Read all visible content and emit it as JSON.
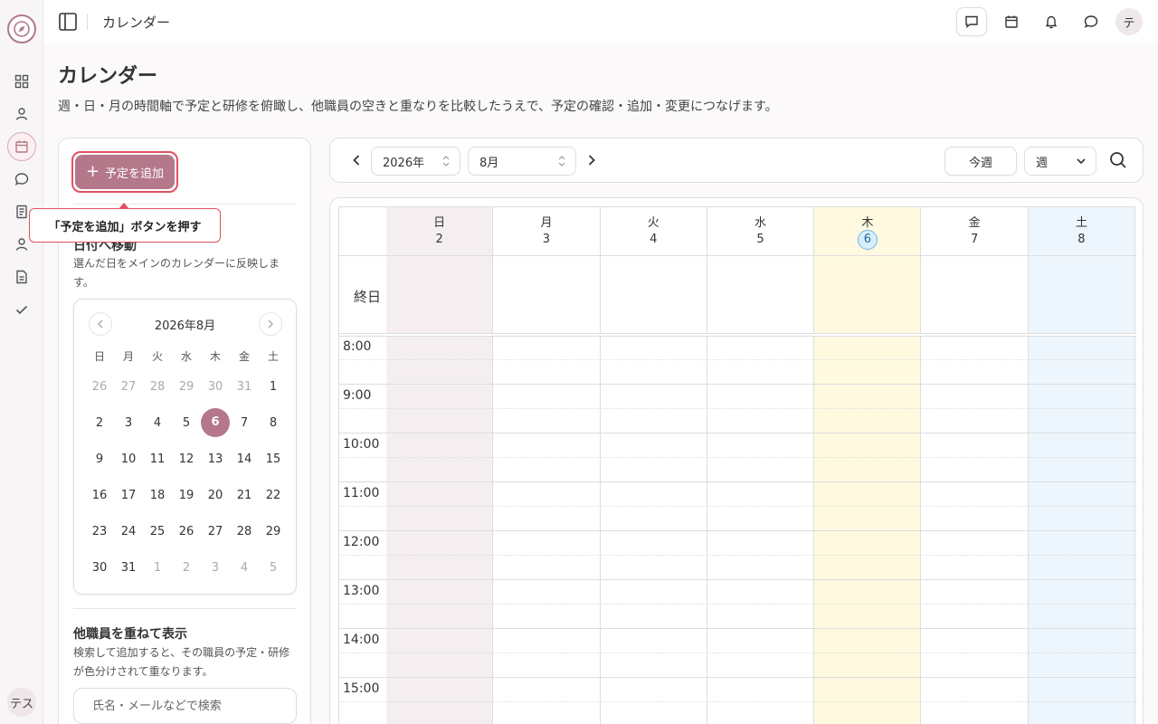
{
  "app": {
    "rail_avatar": "テス",
    "topbar_title": "カレンダー",
    "topbar_avatar": "テ"
  },
  "page": {
    "title": "カレンダー",
    "description": "週・日・月の時間軸で予定と研修を俯瞰し、他職員の空きと重なりを比較したうえで、予定の確認・追加・変更につなげます。"
  },
  "left": {
    "add_button_label": "予定を追加",
    "tooltip": "「予定を追加」ボタンを押す",
    "jump_title": "日付へ移動",
    "jump_desc": "選んだ日をメインのカレンダーに反映します。",
    "mini_cal": {
      "title": "2026年8月",
      "weekdays": [
        "日",
        "月",
        "火",
        "水",
        "木",
        "金",
        "土"
      ],
      "weeks": [
        [
          "26",
          "27",
          "28",
          "29",
          "30",
          "31",
          "1"
        ],
        [
          "2",
          "3",
          "4",
          "5",
          "6",
          "7",
          "8"
        ],
        [
          "9",
          "10",
          "11",
          "12",
          "13",
          "14",
          "15"
        ],
        [
          "16",
          "17",
          "18",
          "19",
          "20",
          "21",
          "22"
        ],
        [
          "23",
          "24",
          "25",
          "26",
          "27",
          "28",
          "29"
        ],
        [
          "30",
          "31",
          "1",
          "2",
          "3",
          "4",
          "5"
        ]
      ],
      "selected": "6"
    },
    "overlay_title": "他職員を重ねて表示",
    "overlay_desc": "検索して追加すると、その職員の予定・研修が色分けされて重なります。",
    "search_placeholder": "氏名・メールなどで検索"
  },
  "toolbar": {
    "year": "2026年",
    "month": "8月",
    "today_label": "今週",
    "view": "週"
  },
  "week": {
    "days": [
      {
        "weekday": "日",
        "date": "2"
      },
      {
        "weekday": "月",
        "date": "3"
      },
      {
        "weekday": "火",
        "date": "4"
      },
      {
        "weekday": "水",
        "date": "5"
      },
      {
        "weekday": "木",
        "date": "6"
      },
      {
        "weekday": "金",
        "date": "7"
      },
      {
        "weekday": "土",
        "date": "8"
      }
    ],
    "all_day_label": "終日",
    "hours": [
      "8:00",
      "9:00",
      "10:00",
      "11:00",
      "12:00",
      "13:00",
      "14:00",
      "15:00"
    ]
  },
  "colors": {
    "accent": "#b4788a",
    "highlight_ring": "#e05161",
    "today_column": "#fff9e0",
    "sunday_column": "#f5eef0",
    "saturday_column": "#eef6fd"
  },
  "icons": {
    "rail": [
      "dashboard-icon",
      "user-icon",
      "calendar-icon",
      "chat-icon",
      "notebook-icon",
      "user-icon",
      "document-icon",
      "check-icon"
    ],
    "topbar": [
      "message-square-icon",
      "calendar-icon",
      "bell-icon",
      "chat-bubble-icon"
    ]
  }
}
